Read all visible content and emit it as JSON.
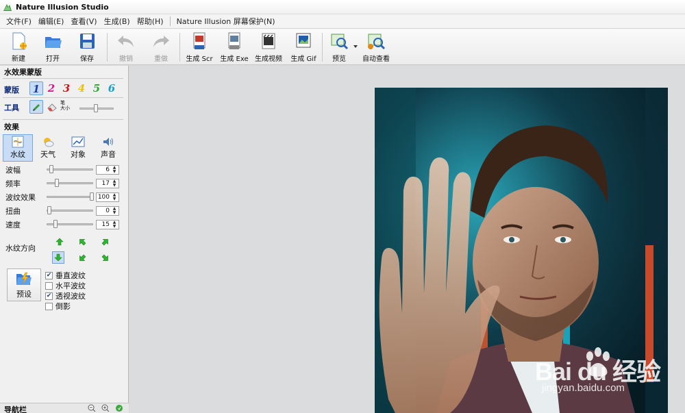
{
  "window": {
    "title": "Nature Illusion Studio"
  },
  "menu": {
    "items": [
      "文件(F)",
      "编辑(E)",
      "查看(V)",
      "生成(B)",
      "帮助(H)"
    ],
    "extra": "Nature Illusion 屏幕保护(N)"
  },
  "toolbar": {
    "new": "新建",
    "open": "打开",
    "save": "保存",
    "undo": "撤销",
    "redo": "重做",
    "gen_scr": "生成 Scr",
    "gen_exe": "生成 Exe",
    "gen_video": "生成视频",
    "gen_gif": "生成 Gif",
    "preview": "预览",
    "auto_view": "自动查看"
  },
  "mask_panel": {
    "title": "水效果蒙版",
    "mask_label": "蒙版",
    "mask_numbers": [
      "1",
      "2",
      "3",
      "4",
      "5",
      "6"
    ],
    "mask_colors": [
      "#1a3aa8",
      "#d81b8c",
      "#d4121a",
      "#e8c21a",
      "#2ea82e",
      "#17a2c8"
    ],
    "tool_label": "工具",
    "size_label_1": "笔",
    "size_label_2": "大小"
  },
  "effects": {
    "title": "效果",
    "tabs": [
      "水纹",
      "天气",
      "对象",
      "声音"
    ],
    "params": [
      {
        "label": "波幅",
        "value": "6",
        "level": 0.05
      },
      {
        "label": "频率",
        "value": "17",
        "level": 0.17
      },
      {
        "label": "波纹效果",
        "value": "100",
        "level": 1.0
      },
      {
        "label": "扭曲",
        "value": "0",
        "level": 0.0
      },
      {
        "label": "速度",
        "value": "15",
        "level": 0.15
      }
    ],
    "direction_label": "水纹方向",
    "preset_label": "预设",
    "checkboxes": [
      {
        "label": "垂直波纹",
        "checked": true
      },
      {
        "label": "水平波纹",
        "checked": false
      },
      {
        "label": "透视波纹",
        "checked": true
      },
      {
        "label": "倒影",
        "checked": false
      }
    ]
  },
  "nav": {
    "title": "导航栏"
  },
  "watermark": {
    "logo": "Bai du 经验",
    "url": "jingyan.baidu.com"
  }
}
